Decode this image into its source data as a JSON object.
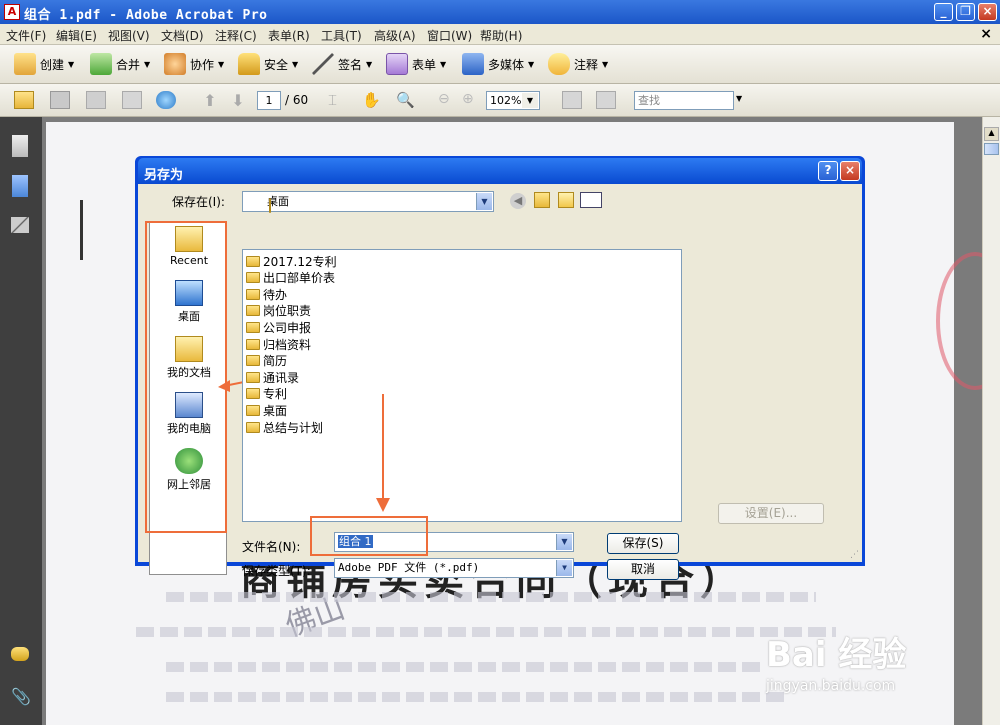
{
  "window": {
    "title": "组合 1.pdf - Adobe Acrobat Pro",
    "min": "_",
    "max": "❐",
    "close": "×"
  },
  "menu": {
    "items": [
      "文件(F)",
      "编辑(E)",
      "视图(V)",
      "文档(D)",
      "注释(C)",
      "表单(R)",
      "工具(T)",
      "高级(A)",
      "窗口(W)",
      "帮助(H)"
    ],
    "close": "×"
  },
  "toolbar": {
    "create": "创建",
    "combine": "合并",
    "collaborate": "协作",
    "secure": "安全",
    "sign": "签名",
    "forms": "表单",
    "multimedia": "多媒体",
    "comment": "注释"
  },
  "nav": {
    "page": "1",
    "total": "/ 60",
    "zoom": "102%",
    "find_placeholder": "查找"
  },
  "document": {
    "heading": "商铺房买卖合同（现合）",
    "stamp": "佛山",
    "watermark_brand": "Bai 经验",
    "watermark_url": "jingyan.baidu.com"
  },
  "dialog": {
    "title": "另存为",
    "help": "?",
    "close": "×",
    "save_in_label": "保存在(I):",
    "save_in_value": "桌面",
    "places": [
      "Recent",
      "桌面",
      "我的文档",
      "我的电脑",
      "网上邻居"
    ],
    "files": [
      "2017.12专利",
      "出口部单价表",
      "待办",
      "岗位职责",
      "公司申报",
      "归档资料",
      "简历",
      "通讯录",
      "专利",
      "桌面",
      "总结与计划"
    ],
    "filename_label": "文件名(N):",
    "filename_value": "组合 1",
    "filetype_label": "保存类型(T):",
    "filetype_value": "Adobe PDF 文件 (*.pdf)",
    "save_button": "保存(S)",
    "cancel_button": "取消",
    "settings_button": "设置(E)..."
  },
  "colors": {
    "annotation": "#ee6d3a",
    "xp_blue": "#0a47d8"
  }
}
